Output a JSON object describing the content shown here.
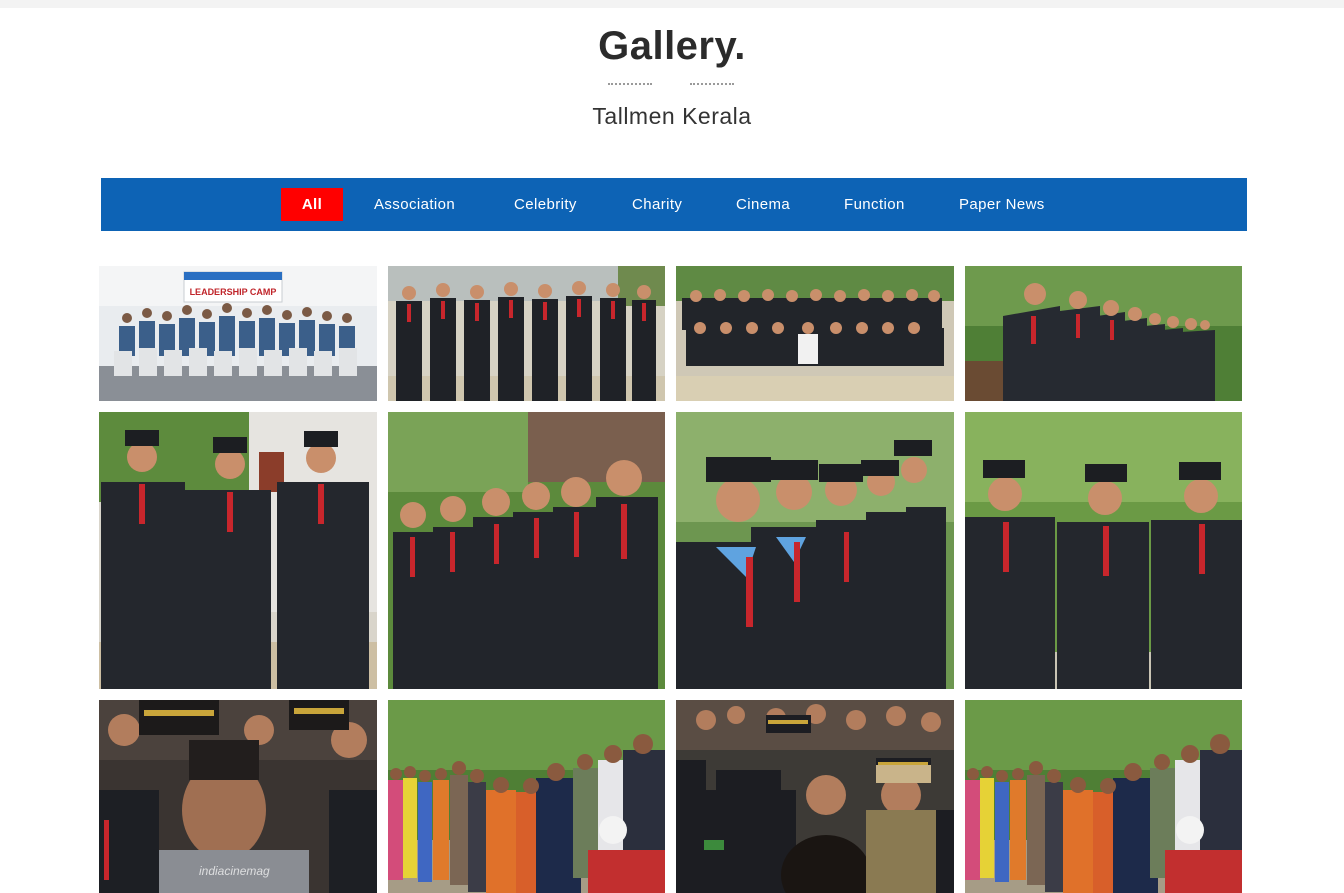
{
  "header": {
    "title": "Gallery.",
    "subtitle": "Tallmen Kerala"
  },
  "filters": [
    {
      "label": "All",
      "active": true
    },
    {
      "label": "Association",
      "active": false
    },
    {
      "label": "Celebrity",
      "active": false
    },
    {
      "label": "Charity",
      "active": false
    },
    {
      "label": "Cinema",
      "active": false
    },
    {
      "label": "Function",
      "active": false
    },
    {
      "label": "Paper News",
      "active": false
    }
  ],
  "colors": {
    "filter_bar": "#0d63b5",
    "active_filter": "#ff0000",
    "uniform": "#23262b",
    "foliage": "#4f8a3a"
  },
  "gallery": {
    "tiles": [
      {
        "subject": "group-photo-banner",
        "banner_text": "LEADERSHIP CAMP"
      },
      {
        "subject": "uniformed-line-up"
      },
      {
        "subject": "uniformed-group-seated"
      },
      {
        "subject": "uniformed-line-diagonal"
      },
      {
        "subject": "three-officers"
      },
      {
        "subject": "officers-row"
      },
      {
        "subject": "officers-closeup"
      },
      {
        "subject": "three-officers-trees"
      },
      {
        "subject": "celebrity-crowd",
        "watermark": "indiacinemag"
      },
      {
        "subject": "charity-distribution"
      },
      {
        "subject": "celebrity-crowd-2"
      },
      {
        "subject": "charity-distribution-2"
      }
    ]
  }
}
